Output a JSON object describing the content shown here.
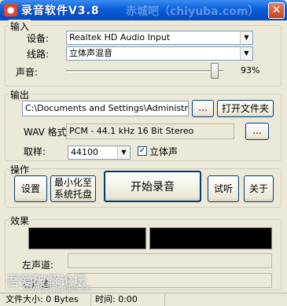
{
  "window": {
    "title": "录音软件V3.8",
    "watermark": "赤城吧（chiyuba.com）",
    "close_glyph": "✕"
  },
  "input_group": {
    "title": "输入",
    "device_label": "设备:",
    "device_value": "Realtek HD Audio Input",
    "line_label": "线路:",
    "line_value": "立体声混音",
    "volume_label": "声音:",
    "volume_value": 0.93,
    "volume_text": "93%"
  },
  "output_group": {
    "title": "输出",
    "path_value": "C:\\Documents and Settings\\Administrator\\桌",
    "browse_label": "...",
    "open_folder_label": "打开文件夹",
    "wav_format_label": "WAV 格式:",
    "wav_format_value": "PCM - 44.1 kHz 16 Bit Stereo",
    "format_button_label": "...",
    "sample_label": "取样:",
    "sample_value": "44100",
    "stereo_label": "立体声",
    "stereo_checked": true
  },
  "operation_group": {
    "title": "操作",
    "settings_label": "设置",
    "minimize_label_1": "最小化至",
    "minimize_label_2": "系统托盘",
    "start_label": "开始录音",
    "listen_label": "试听",
    "about_label": "关于"
  },
  "effect_group": {
    "title": "效果",
    "left_channel_label": "左声道:",
    "right_channel_label": "右声道:"
  },
  "status": {
    "file_size": "文件大小: 0 Bytes",
    "time": "时间: 0:00"
  },
  "overlay": {
    "forum_watermark": "吾爱破解论坛",
    "url_watermark": "www.52pojie.cn"
  }
}
